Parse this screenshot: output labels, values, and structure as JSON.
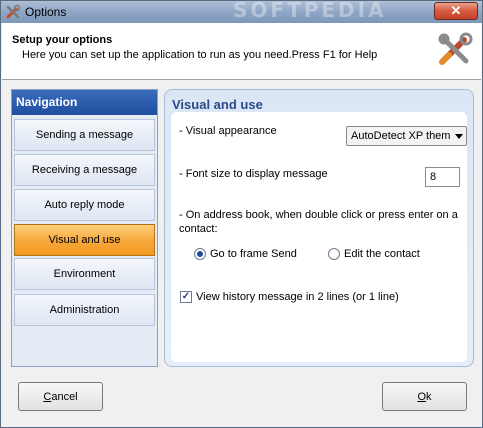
{
  "window": {
    "title": "Options",
    "watermark": "SOFTPEDIA"
  },
  "header": {
    "title": "Setup your options",
    "subtitle": "Here you can set up the application to run as you need.Press F1 for Help"
  },
  "nav": {
    "title": "Navigation",
    "items": [
      {
        "label": "Sending a message"
      },
      {
        "label": "Receiving a message"
      },
      {
        "label": "Auto reply mode"
      },
      {
        "label": "Visual and use"
      },
      {
        "label": "Environment"
      },
      {
        "label": "Administration"
      }
    ],
    "active_index": 3
  },
  "panel": {
    "title": "Visual and use",
    "visual_appearance_label": "- Visual appearance",
    "visual_appearance_value": "AutoDetect XP them",
    "font_size_label": "- Font size to display message",
    "font_size_value": "8",
    "address_book_label_1": "- On address book, when double click or press enter on a",
    "address_book_label_2": "contact:",
    "radio_go_to_frame": "Go to frame Send",
    "radio_edit_contact": "Edit the contact",
    "checkbox_history": "View history message in 2 lines (or 1 line)"
  },
  "buttons": {
    "cancel_first": "C",
    "cancel_rest": "ancel",
    "ok_first": "O",
    "ok_rest": "k"
  },
  "colors": {
    "accent": "#1f4e9e",
    "active_tab": "#f7a73a",
    "panel_title": "#2a4b8a"
  }
}
